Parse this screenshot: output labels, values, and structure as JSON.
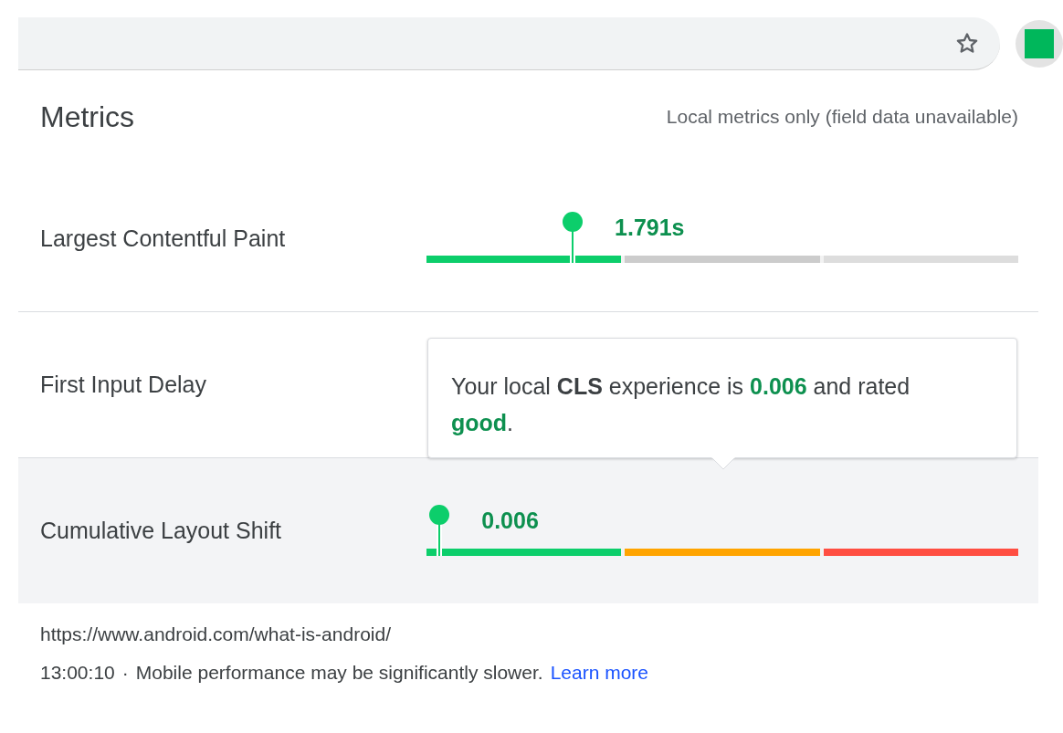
{
  "title": "Metrics",
  "source_note": "Local metrics only (field data unavailable)",
  "metrics": [
    {
      "name": "Largest Contentful Paint",
      "value": "1.791s",
      "level": 0.247,
      "highlighted": false,
      "segments": [
        {
          "color": "#0cce6b"
        },
        {
          "color": "#cccccc"
        },
        {
          "color": "#dddddd"
        }
      ]
    },
    {
      "name": "First Input Delay",
      "highlighted": false
    },
    {
      "name": "Cumulative Layout Shift",
      "value": "0.006",
      "level": 0.022,
      "highlighted": true,
      "segments": [
        {
          "color": "#0cce6b"
        },
        {
          "color": "#ffa400"
        },
        {
          "color": "#ff4e42"
        }
      ]
    }
  ],
  "tooltip": {
    "parts": [
      {
        "text": "Your local ",
        "kind": "plain"
      },
      {
        "text": "CLS",
        "kind": "strong"
      },
      {
        "text": " experience is ",
        "kind": "plain"
      },
      {
        "text": "0.006",
        "kind": "good"
      },
      {
        "text": " and rated ",
        "kind": "plain"
      },
      {
        "text": "good",
        "kind": "good"
      },
      {
        "text": ".",
        "kind": "plain"
      }
    ]
  },
  "footer": {
    "url": "https://www.android.com/what-is-android/",
    "time": "13:00:10",
    "separator": "·",
    "note": "Mobile performance may be significantly slower.",
    "link": "Learn more"
  }
}
